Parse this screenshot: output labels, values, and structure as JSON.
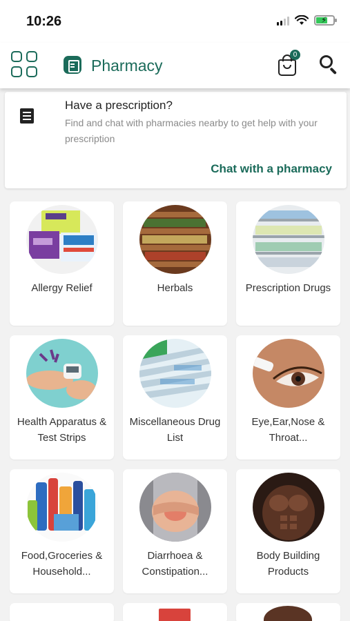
{
  "status_bar": {
    "time": "10:26"
  },
  "app_bar": {
    "title": "Pharmacy",
    "cart_count": "0",
    "icons": [
      "grid-menu-icon",
      "pharmacy-logo-icon",
      "cart-icon",
      "search-icon"
    ]
  },
  "prescription": {
    "title": "Have a prescription?",
    "description": "Find and chat with pharmacies nearby to get help with your prescription",
    "cta": "Chat with a pharmacy",
    "icon": "receipt-icon"
  },
  "categories": [
    {
      "label": "Allergy Relief"
    },
    {
      "label": "Herbals"
    },
    {
      "label": "Prescription Drugs"
    },
    {
      "label": "Health Apparatus & Test Strips"
    },
    {
      "label": "Miscellaneous Drug List"
    },
    {
      "label": "Eye,Ear,Nose & Throat..."
    },
    {
      "label": "Food,Groceries & Household..."
    },
    {
      "label": "Diarrhoea & Constipation..."
    },
    {
      "label": "Body Building Products"
    }
  ],
  "colors": {
    "brand": "#1b6b5a",
    "background": "#f2f2f2",
    "card": "#ffffff"
  }
}
